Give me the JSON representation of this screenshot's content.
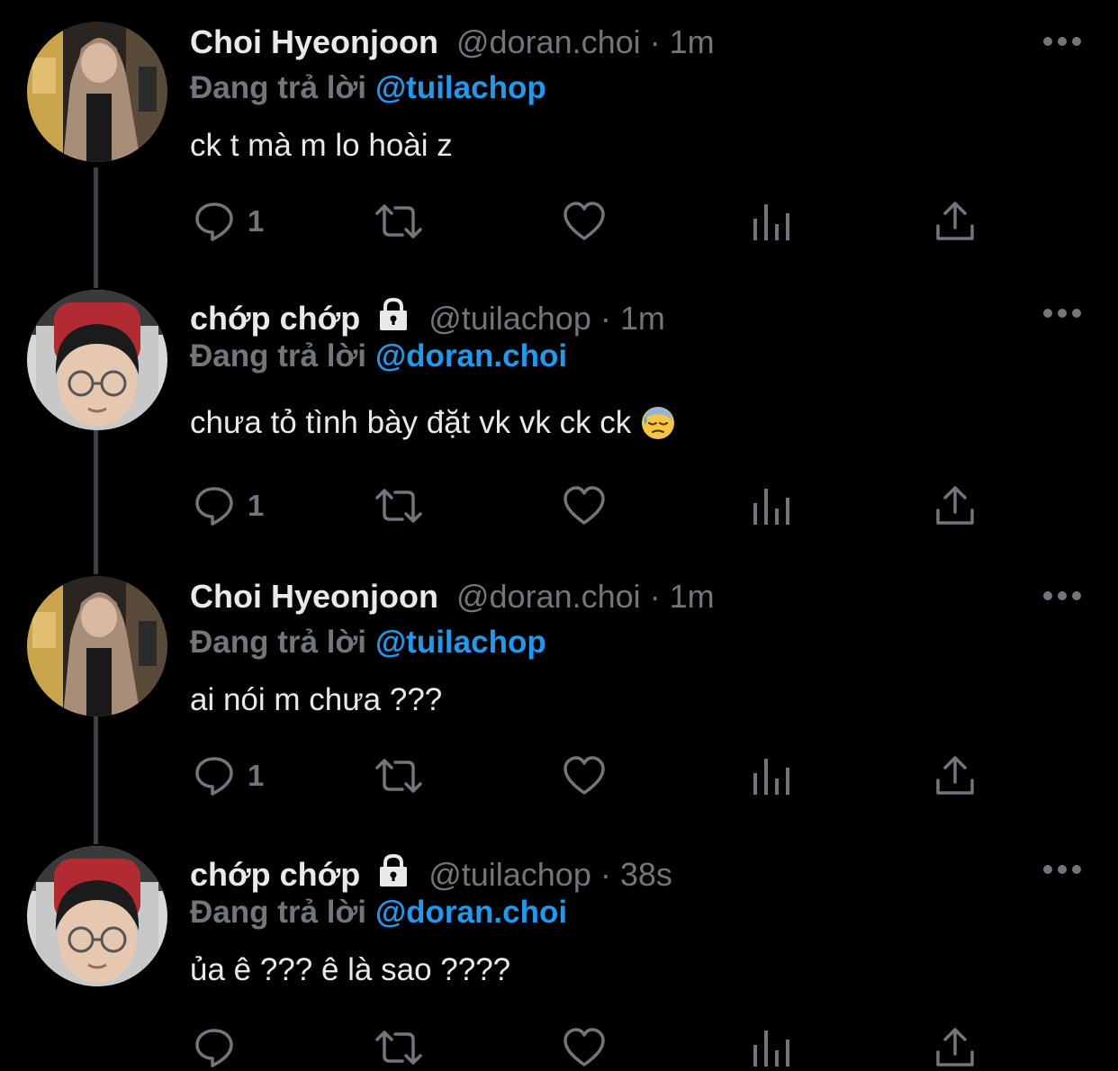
{
  "tweets": [
    {
      "name": "Choi Hyeonjoon",
      "handle": "@doran.choi",
      "dot": "·",
      "time": "1m",
      "locked": false,
      "replying_label": "Đang trả lời",
      "replying_to": "@tuilachop",
      "text": "ck t mà m lo hoài z",
      "reply_count": "1"
    },
    {
      "name": "chớp chớp",
      "handle": "@tuilachop",
      "dot": "·",
      "time": "1m",
      "locked": true,
      "replying_label": "Đang trả lời",
      "replying_to": "@doran.choi",
      "text": "chưa tỏ tình bày đặt vk vk ck ck",
      "emoji": "downcast-face-with-sweat-icon",
      "reply_count": "1"
    },
    {
      "name": "Choi Hyeonjoon",
      "handle": "@doran.choi",
      "dot": "·",
      "time": "1m",
      "locked": false,
      "replying_label": "Đang trả lời",
      "replying_to": "@tuilachop",
      "text": "ai nói m chưa ???",
      "reply_count": "1"
    },
    {
      "name": "chớp chớp",
      "handle": "@tuilachop",
      "dot": "·",
      "time": "38s",
      "locked": true,
      "replying_label": "Đang trả lời",
      "replying_to": "@doran.choi",
      "text": "ủa ê ??? ê là sao ????",
      "reply_count": ""
    }
  ],
  "colors": {
    "background": "#000000",
    "text_primary": "#e7e9ea",
    "text_secondary": "#71767b",
    "mention": "#1d9bf0",
    "thread_line": "#3d4144"
  }
}
